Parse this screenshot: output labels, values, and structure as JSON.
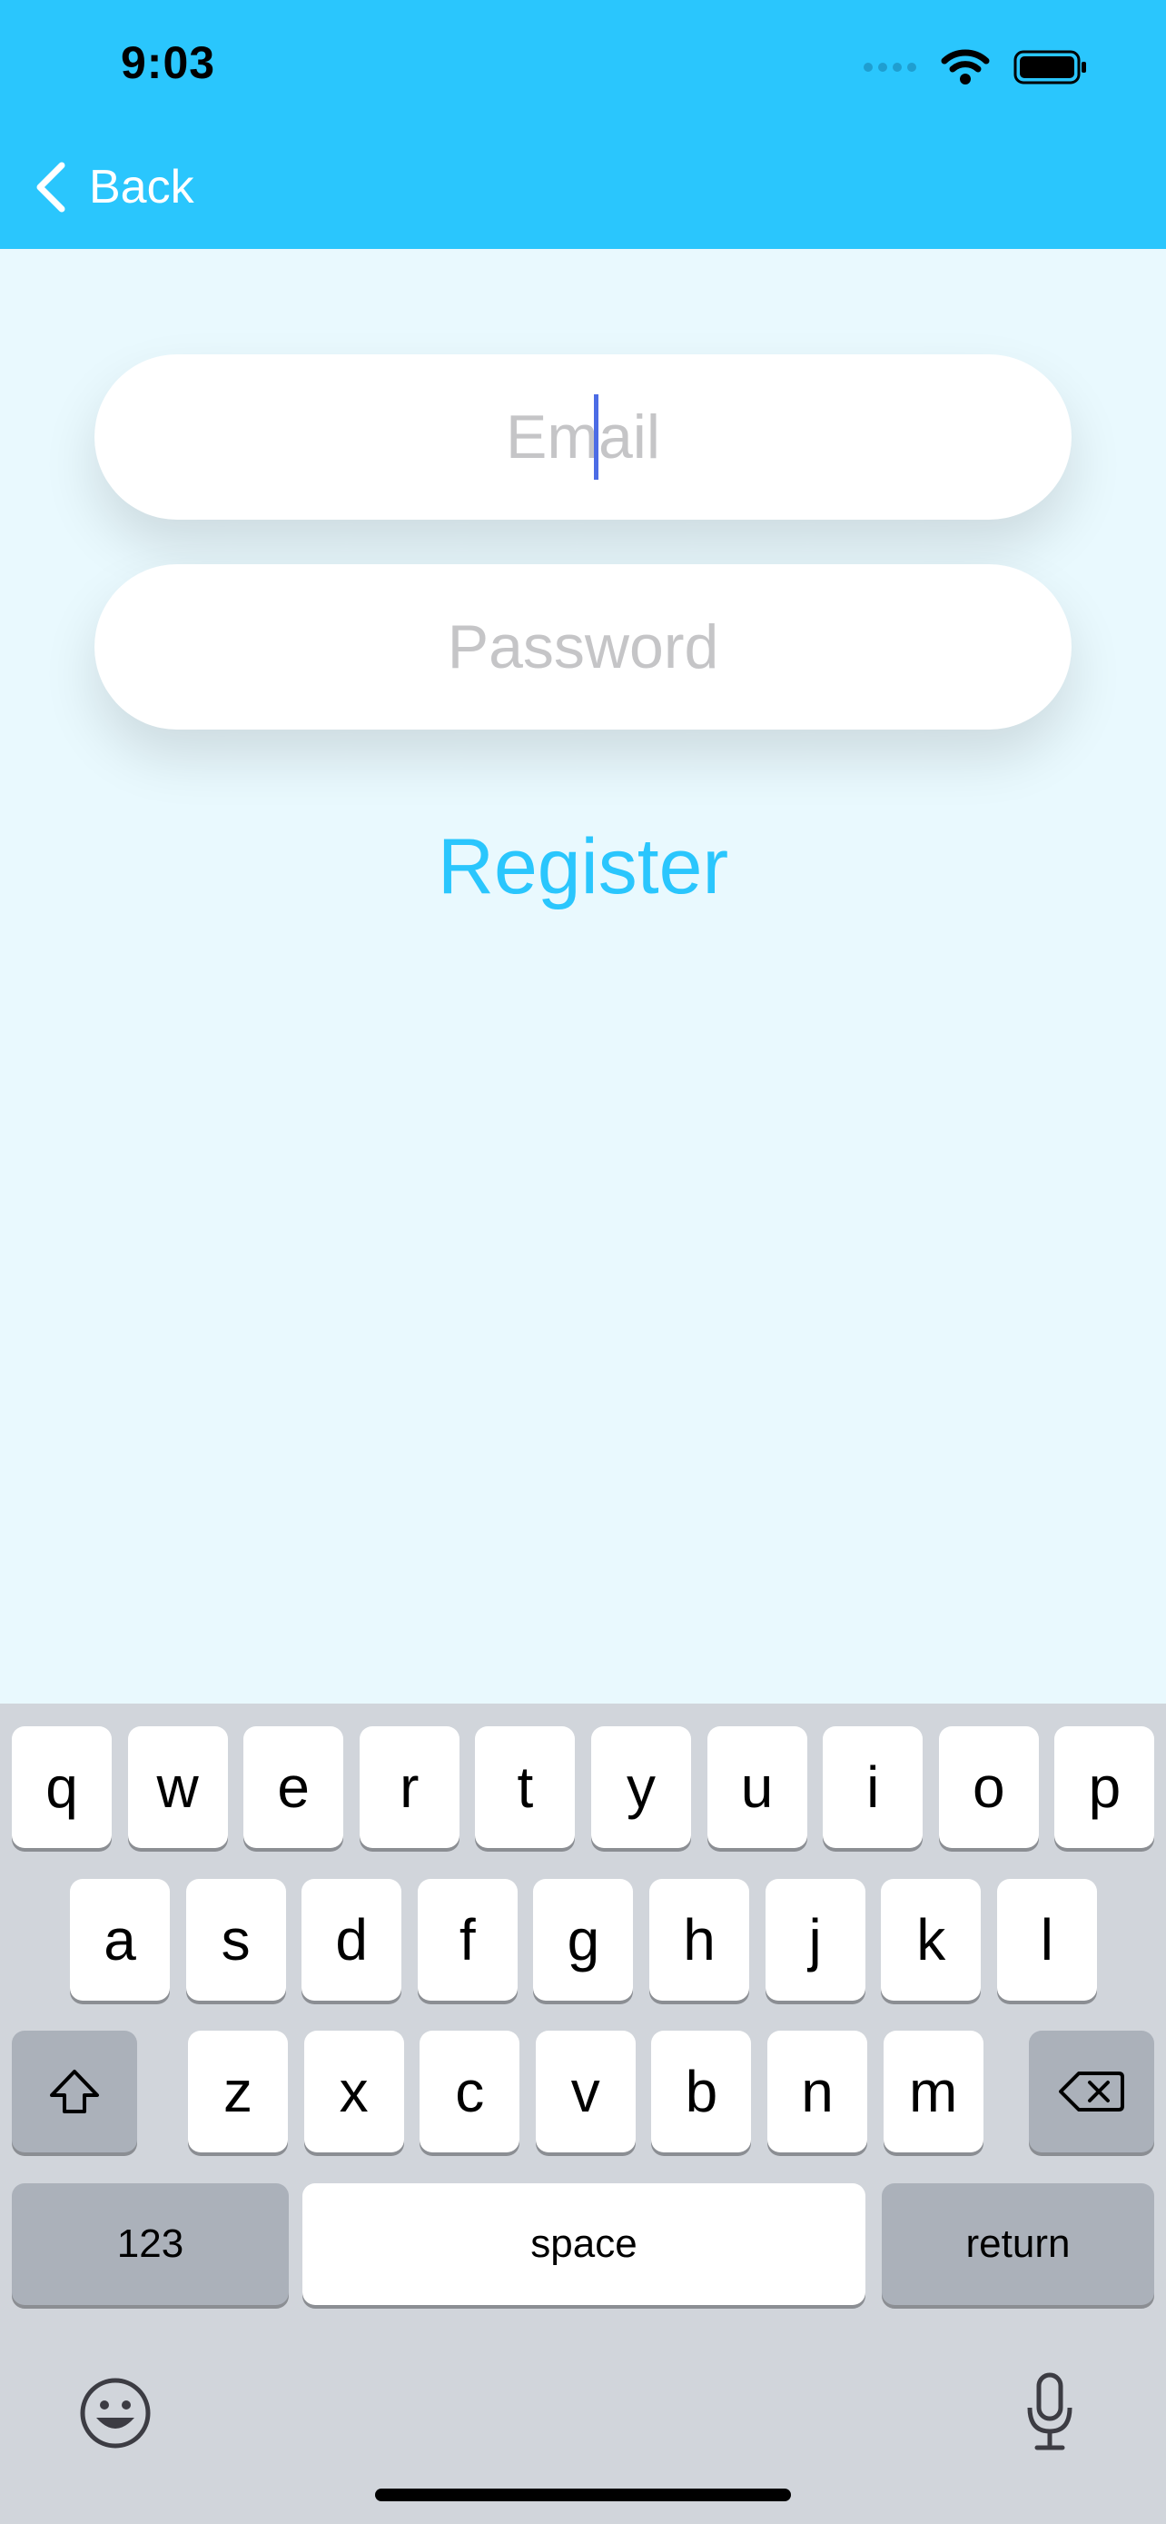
{
  "status_bar": {
    "time": "9:03"
  },
  "nav": {
    "back_label": "Back"
  },
  "form": {
    "email_placeholder": "Email",
    "password_placeholder": "Password",
    "register_label": "Register"
  },
  "keyboard": {
    "row1": [
      "q",
      "w",
      "e",
      "r",
      "t",
      "y",
      "u",
      "i",
      "o",
      "p"
    ],
    "row2": [
      "a",
      "s",
      "d",
      "f",
      "g",
      "h",
      "j",
      "k",
      "l"
    ],
    "row3": [
      "z",
      "x",
      "c",
      "v",
      "b",
      "n",
      "m"
    ],
    "numbers_label": "123",
    "space_label": "space",
    "return_label": "return"
  },
  "colors": {
    "header": "#2ac6fd",
    "background": "#e9f9fe",
    "accent": "#2ac6fd",
    "keyboard": "#d1d5db",
    "cursor": "#4c6ce5"
  }
}
